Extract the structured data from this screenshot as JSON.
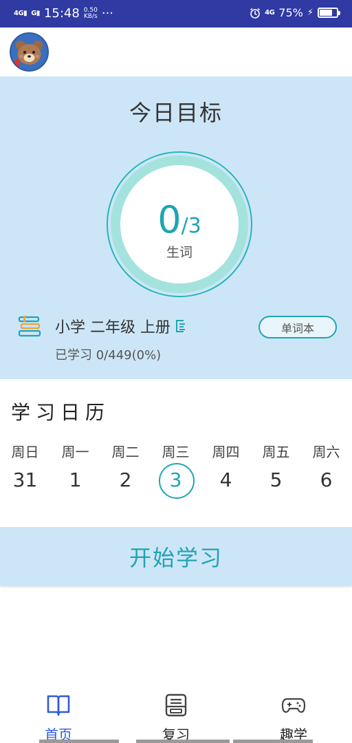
{
  "status_bar": {
    "sig1": "4G",
    "sig2": "G",
    "time": "15:48",
    "net_speed_value": "0.50",
    "net_speed_unit": "KB/s",
    "more": "···",
    "net_type": "4G",
    "battery": "75%",
    "battery_level": 0.75
  },
  "goal": {
    "title": "今日目标",
    "learned": "0",
    "target": "/3",
    "unit": "生词"
  },
  "book": {
    "title": "小学 二年级 上册",
    "progress": "已学习 0/449(0%)",
    "wordbook_button": "单词本"
  },
  "calendar": {
    "title": "学习日历",
    "weekdays": [
      "周日",
      "周一",
      "周二",
      "周三",
      "周四",
      "周五",
      "周六"
    ],
    "days": [
      "31",
      "1",
      "2",
      "3",
      "4",
      "5",
      "6"
    ],
    "today_index": 3
  },
  "start_button": "开始学习",
  "nav": {
    "items": [
      {
        "label": "首页",
        "icon": "book-open-icon",
        "active": true
      },
      {
        "label": "复习",
        "icon": "review-printer-icon",
        "active": false
      },
      {
        "label": "趣学",
        "icon": "gamepad-icon",
        "active": false
      }
    ]
  },
  "colors": {
    "accent": "#1fa4b4",
    "panel": "#cde6f7",
    "status_bar": "#2f3aa3",
    "nav_active": "#2d5bd6"
  }
}
